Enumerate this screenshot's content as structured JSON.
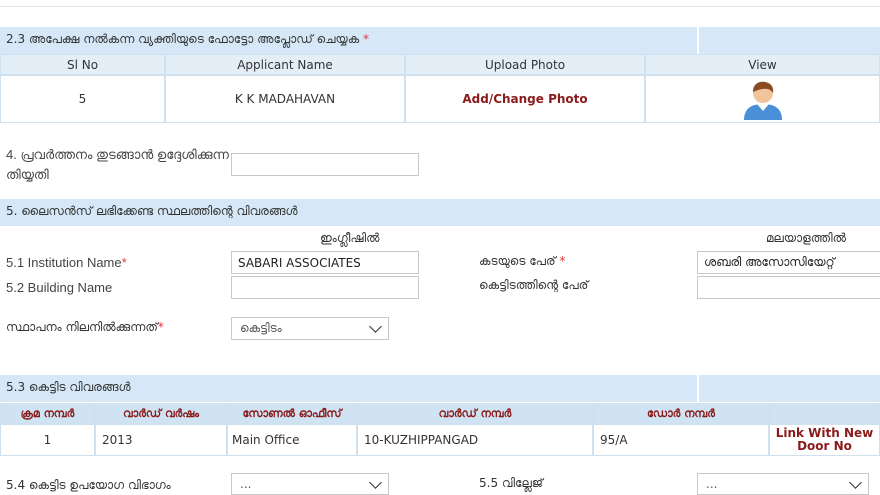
{
  "section23": {
    "title": "2.3 അപേക്ഷ നൽകന്ന വ്യക്തിയുടെ ഫോട്ടോ അപ്ലോഡ് ചെയ്യക",
    "req": "*",
    "headers": [
      "Sl No",
      "Applicant Name",
      "Upload Photo",
      "View"
    ],
    "row": {
      "sl": "5",
      "name": "K K MADAHAVAN",
      "upload": "Add/Change Photo"
    }
  },
  "section4": {
    "label": "4. പ്രവർത്തനം തുടങ്ങാൻ ഉദ്ദേശിക്കുന്ന തിയ്യതി",
    "value": ""
  },
  "section5": {
    "title": "5. ലൈസൻസ് ലഭിക്കേണ്ട സ്ഥലത്തിന്റെ വിവരങ്ങൾ",
    "english_head": "ഇംഗ്ലീഷിൽ",
    "malayalam_head": "മലയാളത്തിൽ",
    "institution_label": "5.1 Institution Name",
    "institution_value": "SABARI ASSOCIATES",
    "shop_label": "കടയുടെ പേര്",
    "shop_value": "ശബരി അസോസിയേറ്റ്",
    "building_label": "5.2 Building Name",
    "building_value": "",
    "building_ml_label": "കെട്ടിടത്തിന്റെ പേര്",
    "building_ml_value": "",
    "located_label": "സ്ഥാപനം നിലനിൽക്കുന്നത്",
    "located_value": "കെട്ടിടം",
    "req": "*"
  },
  "section53": {
    "title": "5.3 കെട്ടിട വിവരങ്ങൾ",
    "headers": [
      "ക്രമ നമ്പർ",
      "വാർഡ് വർഷം",
      "സോണൽ ഓഫീസ്",
      "വാർഡ് നമ്പർ",
      "ഡോർ നമ്പർ",
      ""
    ],
    "row": {
      "sl": "1",
      "year": "2013",
      "office": "Main Office",
      "ward": "10-KUZHIPPANGAD",
      "door": "95/A",
      "link1": "Link With New",
      "link2": "Door No"
    }
  },
  "section54": {
    "label": "5.4 കെട്ടിട ഉപയോഗ വിഭാഗം",
    "value": "...",
    "village_label": "5.5 വില്ലേജ്",
    "village_value": "..."
  }
}
